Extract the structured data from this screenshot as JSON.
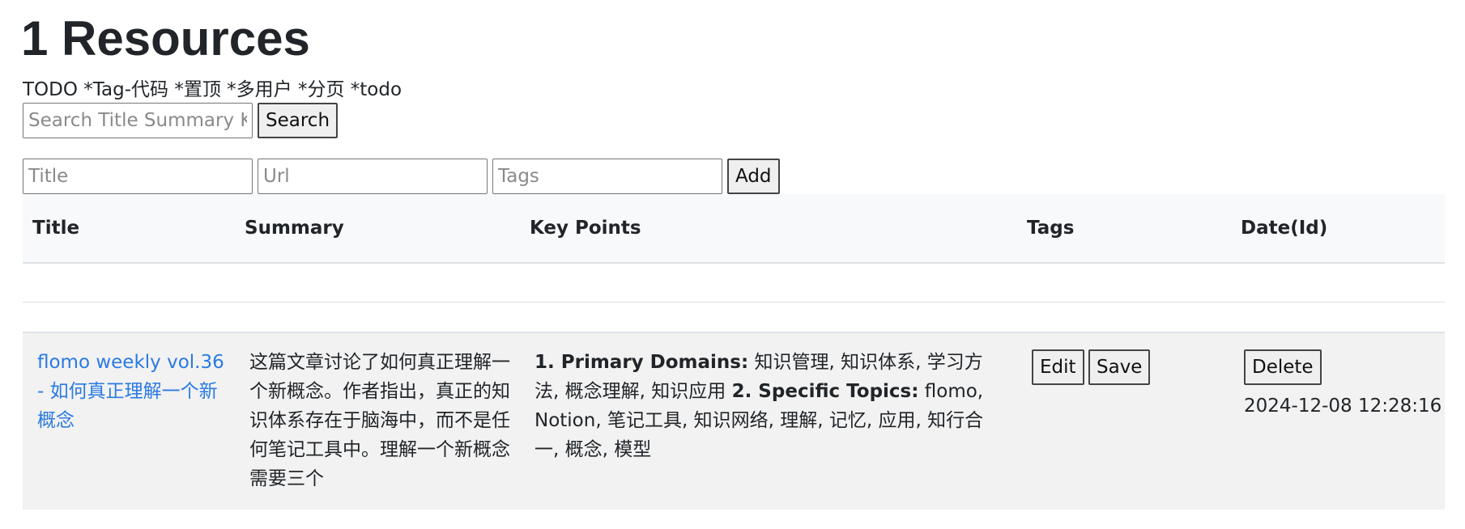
{
  "page_title": "1 Resources",
  "todo_text": "TODO *Tag-代码 *置顶 *多用户 *分页 *todo",
  "search": {
    "placeholder": "Search Title Summary Key",
    "button_label": "Search"
  },
  "add_form": {
    "title_placeholder": "Title",
    "url_placeholder": "Url",
    "tags_placeholder": "Tags",
    "add_label": "Add"
  },
  "table": {
    "headers": [
      "Title",
      "Summary",
      "Key Points",
      "Tags",
      "Date(Id)"
    ],
    "rows": [
      {
        "title": "flomo weekly vol.36 - 如何真正理解一个新概念",
        "summary": "这篇文章讨论了如何真正理解一个新概念。作者指出，真正的知识体系存在于脑海中，而不是任何笔记工具中。理解一个新概念需要三个",
        "key_points": {
          "label1": "1. Primary Domains:",
          "text1": " 知识管理, 知识体系, 学习方法, 概念理解, 知识应用 ",
          "label2": "2. Specific Topics:",
          "text2": " flomo, Notion, 笔记工具, 知识网络, 理解, 记忆, 应用, 知行合一, 概念, 模型"
        },
        "edit_label": "Edit",
        "save_label": "Save",
        "delete_label": "Delete",
        "date": "2024-12-08 12:28:16"
      }
    ]
  },
  "colors": {
    "link": "#2a7ae2",
    "header_bg": "#f8f9fa",
    "row_bg": "#f2f2f2"
  }
}
